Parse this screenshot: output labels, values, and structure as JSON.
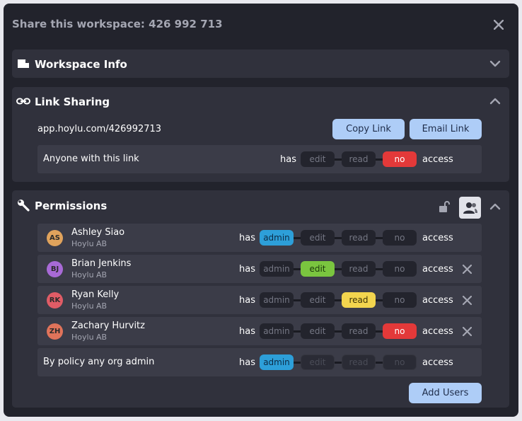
{
  "dialog": {
    "title": "Share this workspace: 426 992 713",
    "close_icon": "close-icon"
  },
  "workspace_info": {
    "title": "Workspace Info",
    "icon": "document-icon",
    "expanded": false
  },
  "link_sharing": {
    "title": "Link Sharing",
    "icon": "link-icon",
    "expanded": true,
    "url": "app.hoylu.com/426992713",
    "copy_label": "Copy Link",
    "email_label": "Email Link",
    "anyone_label": "Anyone with this link",
    "has": "has",
    "access": "access",
    "options": [
      "edit",
      "read",
      "no"
    ],
    "selected": "no"
  },
  "permissions": {
    "title": "Permissions",
    "icon": "wrench-icon",
    "expanded": true,
    "has": "has",
    "access": "access",
    "options": [
      "admin",
      "edit",
      "read",
      "no"
    ],
    "users": [
      {
        "initials": "AS",
        "name": "Ashley Siao",
        "org": "Hoylu AB",
        "color": "#e0a35c",
        "selected": "admin",
        "removable": false
      },
      {
        "initials": "BJ",
        "name": "Brian Jenkins",
        "org": "Hoylu AB",
        "color": "#a86ad6",
        "selected": "edit",
        "removable": true
      },
      {
        "initials": "RK",
        "name": "Ryan Kelly",
        "org": "Hoylu AB",
        "color": "#e05c66",
        "selected": "read",
        "removable": true
      },
      {
        "initials": "ZH",
        "name": "Zachary Hurvitz",
        "org": "Hoylu AB",
        "color": "#e0735a",
        "selected": "no",
        "removable": true
      }
    ],
    "policy": {
      "label": "By policy any org admin",
      "selected": "admin"
    },
    "add_users_label": "Add Users"
  },
  "colors": {
    "admin": "#2d9fd9",
    "edit": "#7ac53f",
    "read": "#f3d54e",
    "no": "#e33939",
    "button": "#aecdf7"
  }
}
